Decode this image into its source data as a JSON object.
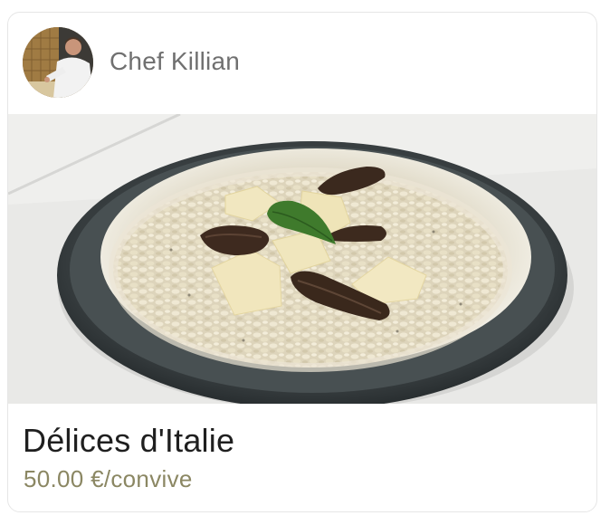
{
  "card": {
    "chef_name": "Chef Killian",
    "dish_title": "Délices d'Italie",
    "price": "50.00 €/convive"
  },
  "icons": {
    "avatar": "chef-portrait",
    "photo": "mushroom-risotto-dish"
  },
  "colors": {
    "chef_name": "#707070",
    "title": "#1f1f1f",
    "price": "#8b8763",
    "border": "#e6e6e6"
  }
}
